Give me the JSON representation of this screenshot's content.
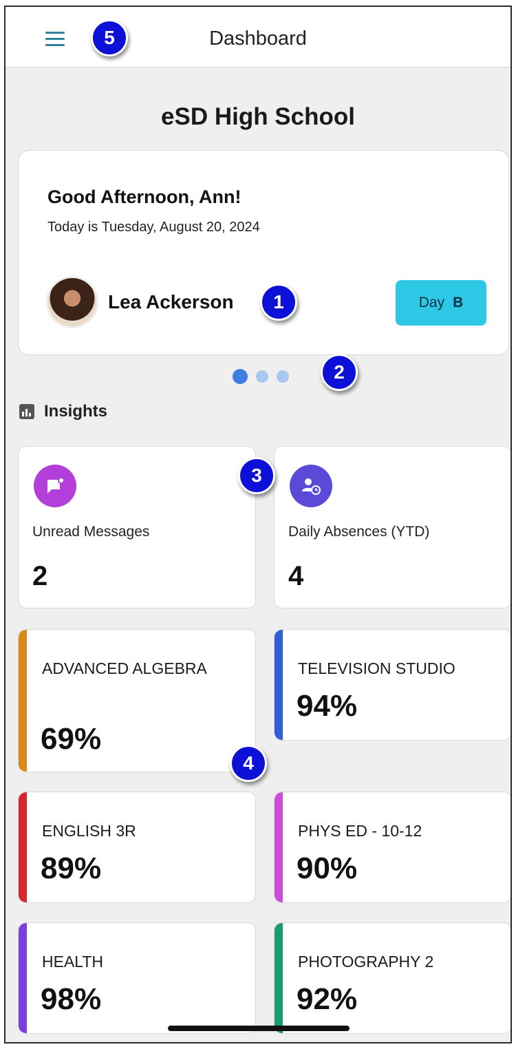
{
  "header": {
    "title": "Dashboard",
    "menu_icon": "hamburger-menu-icon"
  },
  "callouts": [
    "1",
    "2",
    "3",
    "4",
    "5"
  ],
  "school": {
    "name": "eSD High School"
  },
  "welcome": {
    "greeting": "Good Afternoon, Ann!",
    "date": "Today is Tuesday, August 20, 2024",
    "student_name": "Lea Ackerson",
    "day_label": "Day",
    "day_value": "B",
    "day_color": "#2cc8e6"
  },
  "carousel": {
    "pages": 3,
    "active_index": 0
  },
  "insights": {
    "label": "Insights",
    "icon": "bar-chart-icon",
    "stats": [
      {
        "label": "Unread Messages",
        "value": "2",
        "icon": "message-icon",
        "color": "#b23fd9"
      },
      {
        "label": "Daily Absences (YTD)",
        "value": "4",
        "icon": "person-clock-icon",
        "color": "#5b4ad8"
      }
    ]
  },
  "courses": [
    {
      "name": "ADVANCED ALGEBRA",
      "grade": "69%",
      "color": "#d98a1a"
    },
    {
      "name": "TELEVISION STUDIO",
      "grade": "94%",
      "color": "#2f5ed8"
    },
    {
      "name": "ENGLISH 3R",
      "grade": "89%",
      "color": "#d8262f"
    },
    {
      "name": "PHYS ED - 10-12",
      "grade": "90%",
      "color": "#c94fd9"
    },
    {
      "name": "HEALTH",
      "grade": "98%",
      "color": "#7b3fe0"
    },
    {
      "name": "PHOTOGRAPHY 2",
      "grade": "92%",
      "color": "#1a9a6e"
    }
  ]
}
